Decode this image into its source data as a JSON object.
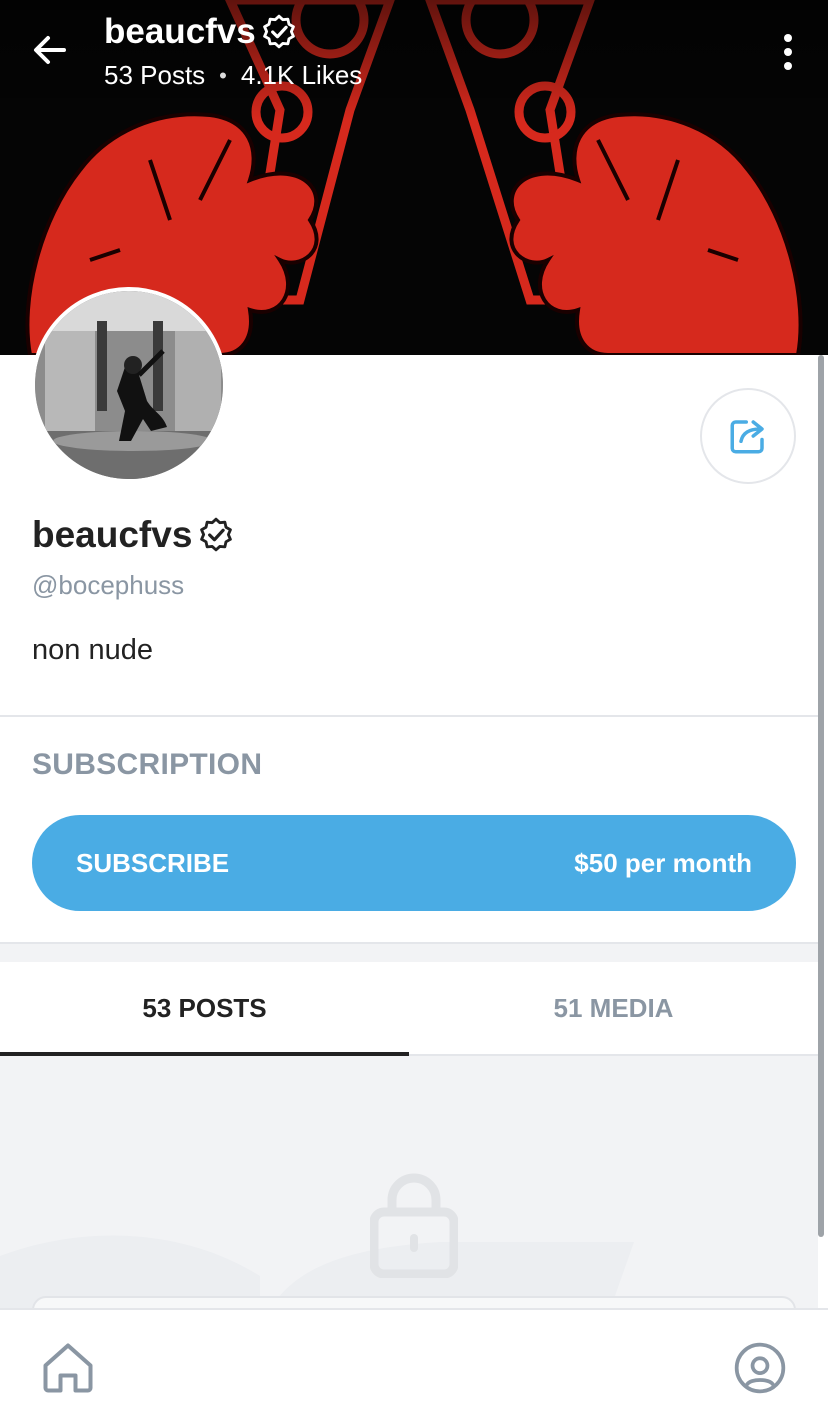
{
  "header": {
    "name": "beaucfvs",
    "posts_stat": "53 Posts",
    "separator": "•",
    "likes_stat": "4.1K Likes"
  },
  "profile": {
    "name": "beaucfvs",
    "handle": "@bocephuss",
    "bio": "non nude"
  },
  "subscription": {
    "heading": "SUBSCRIPTION",
    "button_label": "SUBSCRIBE",
    "price": "$50 per month"
  },
  "tabs": [
    {
      "label": "53 POSTS",
      "active": true
    },
    {
      "label": "51 MEDIA",
      "active": false
    }
  ],
  "icons": {
    "back": "arrow-left-icon",
    "more": "more-vertical-icon",
    "verified": "verified-badge-icon",
    "share": "share-icon",
    "lock": "lock-icon",
    "home": "home-icon",
    "profile": "user-circle-icon"
  },
  "colors": {
    "accent": "#4aace4",
    "muted_text": "#8a96a3",
    "cover_red": "#d6291d"
  }
}
